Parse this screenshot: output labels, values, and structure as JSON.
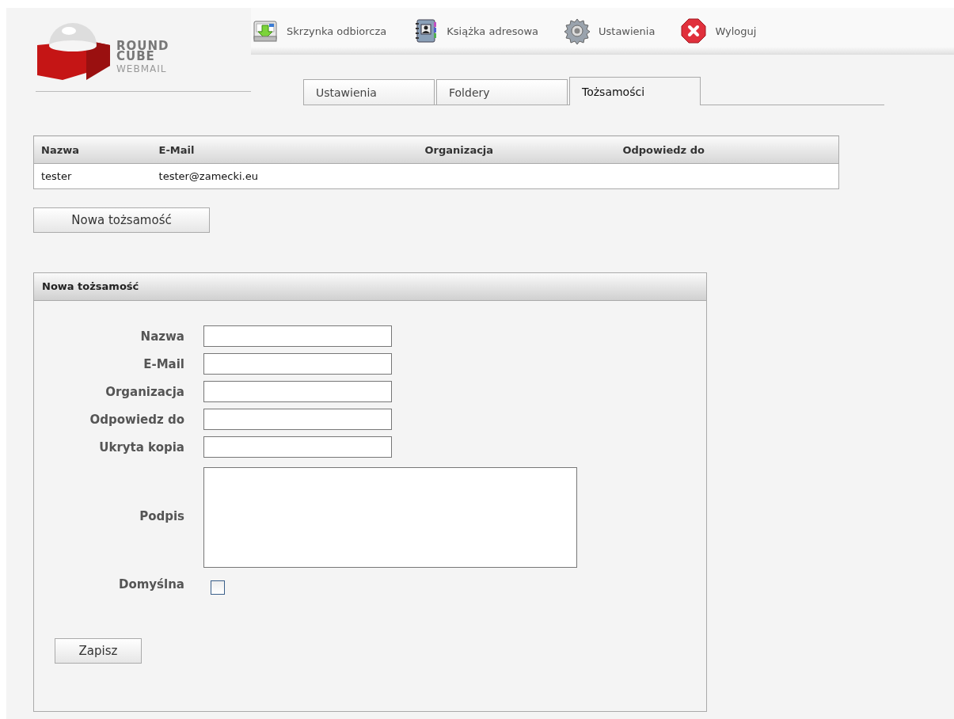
{
  "logo": {
    "lines": [
      "ROUND",
      "CUBE",
      "WEBMAIL"
    ]
  },
  "nav": [
    {
      "label": "Skrzynka odbiorcza",
      "kind": "inbox"
    },
    {
      "label": "Książka adresowa",
      "kind": "addressbook"
    },
    {
      "label": "Ustawienia",
      "kind": "settings"
    },
    {
      "label": "Wyloguj",
      "kind": "logout"
    }
  ],
  "tabs": [
    {
      "label": "Ustawienia",
      "selected": false
    },
    {
      "label": "Foldery",
      "selected": false
    },
    {
      "label": "Tożsamości",
      "selected": true
    }
  ],
  "table": {
    "columns": [
      "Nazwa",
      "E-Mail",
      "Organizacja",
      "Odpowiedz do"
    ],
    "rows": [
      {
        "cells": [
          "tester",
          "tester@zamecki.eu",
          "",
          ""
        ],
        "selected": false
      }
    ]
  },
  "new_button": "Nowa tożsamość",
  "panel": {
    "title": "Nowa tożsamość",
    "fields": [
      {
        "label": "Nazwa",
        "kind": "text"
      },
      {
        "label": "E-Mail",
        "kind": "text"
      },
      {
        "label": "Organizacja",
        "kind": "text"
      },
      {
        "label": "Odpowiedz do",
        "kind": "text"
      },
      {
        "label": "Ukryta kopia",
        "kind": "text"
      },
      {
        "label": "Podpis",
        "kind": "textarea"
      },
      {
        "label": "Domyślna",
        "kind": "checkbox",
        "checked": false
      }
    ],
    "save_button": "Zapisz"
  }
}
